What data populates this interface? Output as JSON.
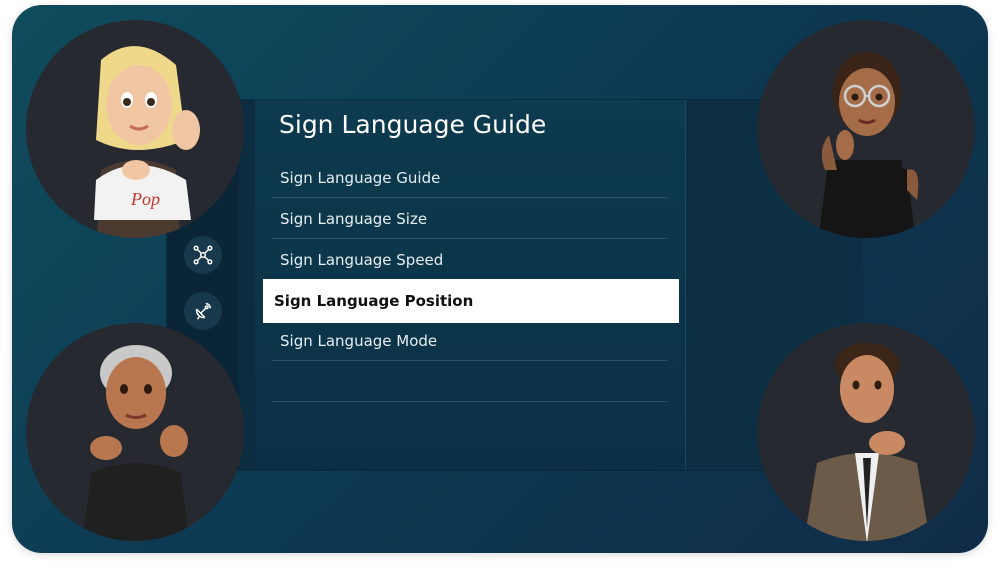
{
  "menu": {
    "title": "Sign Language Guide",
    "items": [
      {
        "label": "Sign Language Guide",
        "selected": false
      },
      {
        "label": "Sign Language Size",
        "selected": false
      },
      {
        "label": "Sign Language Speed",
        "selected": false
      },
      {
        "label": "Sign Language Position",
        "selected": true
      },
      {
        "label": "Sign Language Mode",
        "selected": false
      }
    ]
  },
  "sidebar": {
    "icons": [
      "network-icon",
      "satellite-dish-icon"
    ]
  },
  "avatars": [
    {
      "name": "blonde-woman-avatar",
      "shirt_text": "Pop"
    },
    {
      "name": "woman-with-glasses-avatar"
    },
    {
      "name": "grey-haired-man-avatar"
    },
    {
      "name": "man-in-suit-avatar"
    }
  ],
  "colors": {
    "background_start": "#0f4c5c",
    "background_end": "#102c47",
    "selected_bg": "#ffffff",
    "menu_text": "#e6eef2"
  }
}
